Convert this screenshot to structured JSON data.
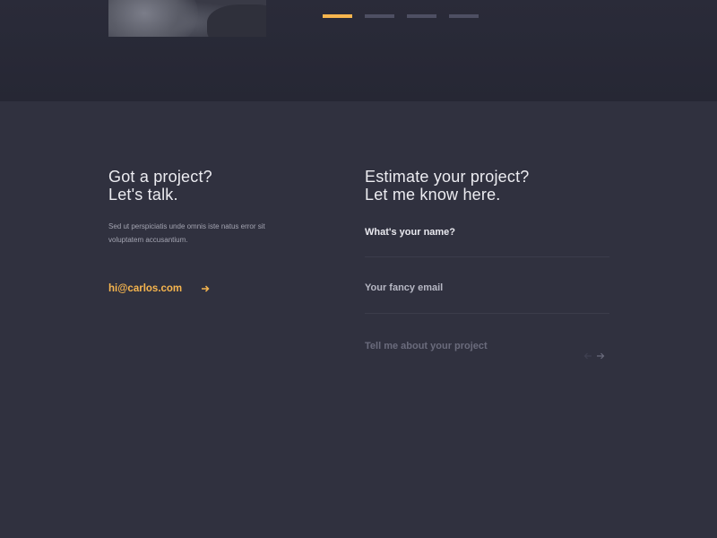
{
  "hero": {
    "photo": "person-photo",
    "slider": [
      {
        "label": "slide 1",
        "active": true
      },
      {
        "label": "slide 2",
        "active": false
      },
      {
        "label": "slide 3",
        "active": false
      },
      {
        "label": "slide 4",
        "active": false
      }
    ]
  },
  "contact": {
    "heading_line1": "Got a project?",
    "heading_line2": "Let's talk.",
    "text": "Sed ut perspiciatis unde omnis iste natus error sit voluptatem accusantium.",
    "email": "hi@carlos.com",
    "email_icon": "arrow-right-icon"
  },
  "form": {
    "heading_line1": "Estimate your project?",
    "heading_line2": "Let me know here.",
    "name_placeholder": "What's your name?",
    "email_placeholder": "Your fancy email",
    "project_placeholder": "Tell me about your project",
    "submit_icon": "arrow-right-icon"
  },
  "colors": {
    "accent": "#f6b54e",
    "background": "#30313f",
    "top_band": "#272836",
    "heading_text": "#ececf1",
    "muted_text": "#a3a4b1"
  }
}
